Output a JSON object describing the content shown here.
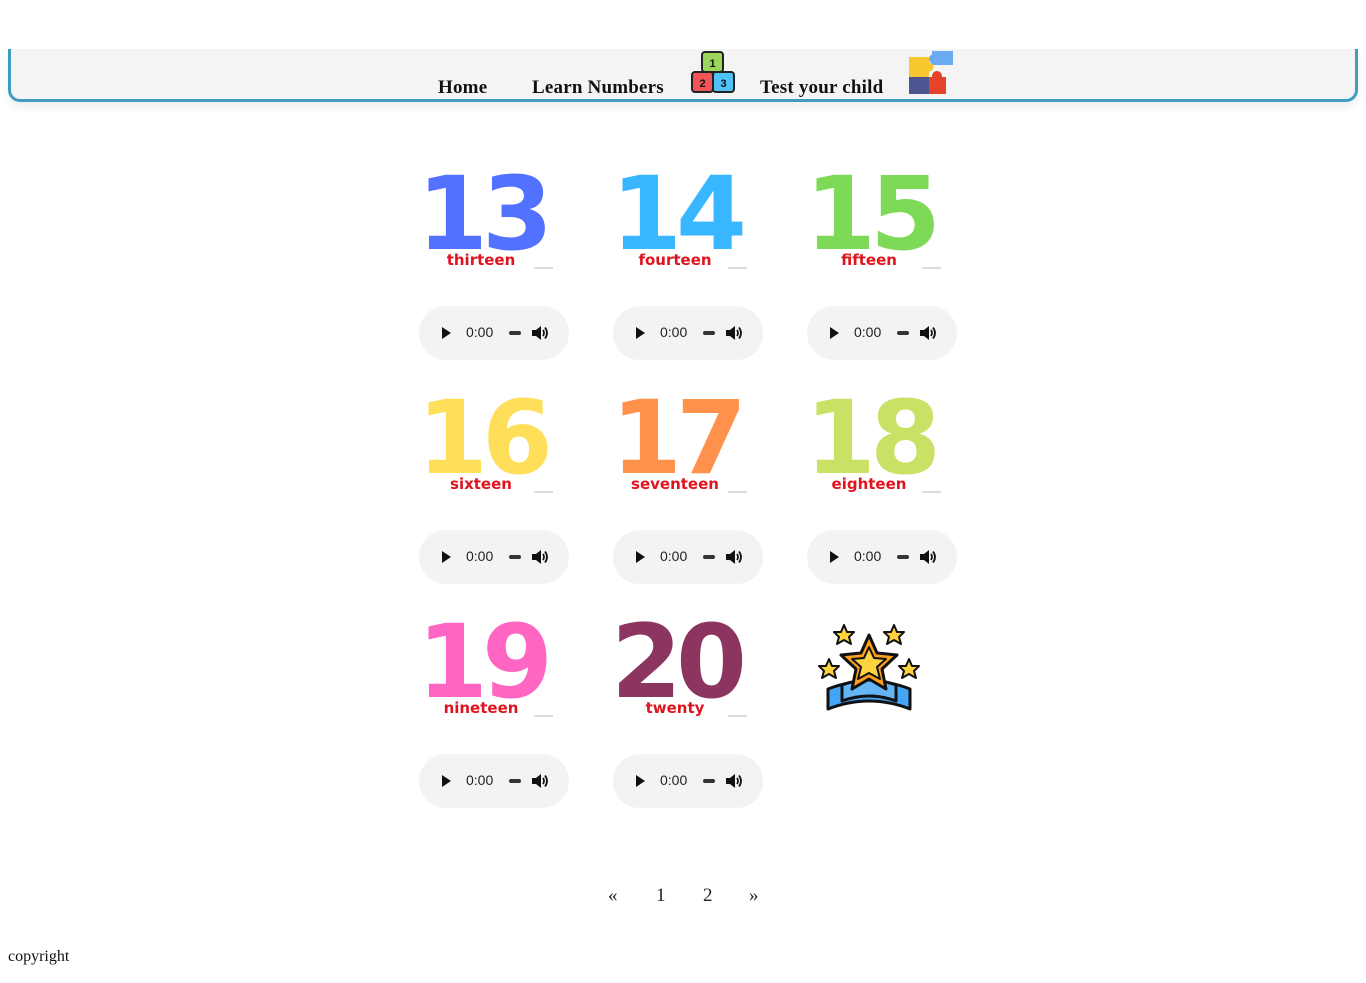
{
  "nav": {
    "home": "Home",
    "learn": "Learn Numbers",
    "test": "Test your child",
    "blocks_icon": "number-blocks-icon",
    "puzzle_icon": "puzzle-icon",
    "block_digits": [
      "1",
      "2",
      "3"
    ]
  },
  "cards": [
    {
      "number": "13",
      "word": "thirteen",
      "color": "#5271ff"
    },
    {
      "number": "14",
      "word": "fourteen",
      "color": "#38b6ff"
    },
    {
      "number": "15",
      "word": "fifteen",
      "color": "#7ed957"
    },
    {
      "number": "16",
      "word": "sixteen",
      "color": "#ffde59"
    },
    {
      "number": "17",
      "word": "seventeen",
      "color": "#ff914d"
    },
    {
      "number": "18",
      "word": "eighteen",
      "color": "#c9e265"
    },
    {
      "number": "19",
      "word": "nineteen",
      "color": "#ff66c4"
    },
    {
      "number": "20",
      "word": "twenty",
      "color": "#8c3560"
    }
  ],
  "word_color": "#e0141e",
  "audio_time": "0:00",
  "reward_icon": "stars-award-icon",
  "pagination": {
    "prev": "«",
    "pages": [
      "1",
      "2"
    ],
    "next": "»"
  },
  "footer": {
    "copyright": "copyright"
  }
}
